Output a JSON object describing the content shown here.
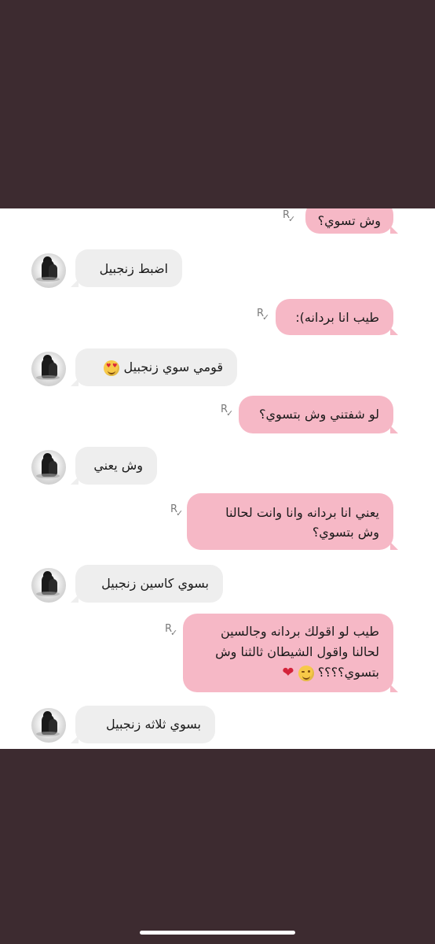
{
  "messages": [
    {
      "id": "m1",
      "from": "me",
      "text": "وش تسوي؟"
    },
    {
      "id": "m2",
      "from": "them",
      "text": "اضبط زنجبيل"
    },
    {
      "id": "m3",
      "from": "me",
      "text": "طيب انا بردانه):"
    },
    {
      "id": "m4",
      "from": "them",
      "text": "قومي سوي زنجبيل",
      "emoji": "heart-eyes-emoji"
    },
    {
      "id": "m5",
      "from": "me",
      "text": "لو شفتني وش بتسوي؟"
    },
    {
      "id": "m6",
      "from": "them",
      "text": "وش يعني"
    },
    {
      "id": "m7",
      "from": "me",
      "lines": [
        "يعني انا بردانه وانا وانت لحالنا",
        "وش بتسوي؟"
      ]
    },
    {
      "id": "m8",
      "from": "them",
      "text": "بسوي كاسين زنجبيل"
    },
    {
      "id": "m9",
      "from": "me",
      "lines": [
        "طيب لو اقولك بردانه وجالسين",
        "لحالنا واقول الشيطان ثالثنا وش",
        "بتسوي؟؟؟؟"
      ],
      "emojis": [
        "wink-emoji",
        "red-heart-emoji"
      ]
    },
    {
      "id": "m10",
      "from": "them",
      "text": "بسوي ثلاثه زنجبيل"
    }
  ],
  "colors": {
    "background": "#3d2b30",
    "chat_background": "#ffffff",
    "sent_bubble": "#f6b8c6",
    "received_bubble": "#eeeeee"
  },
  "receipt_icon": "R",
  "receipt_check": "✓",
  "heart_glyph": "❤",
  "eye_glyph": "♥"
}
